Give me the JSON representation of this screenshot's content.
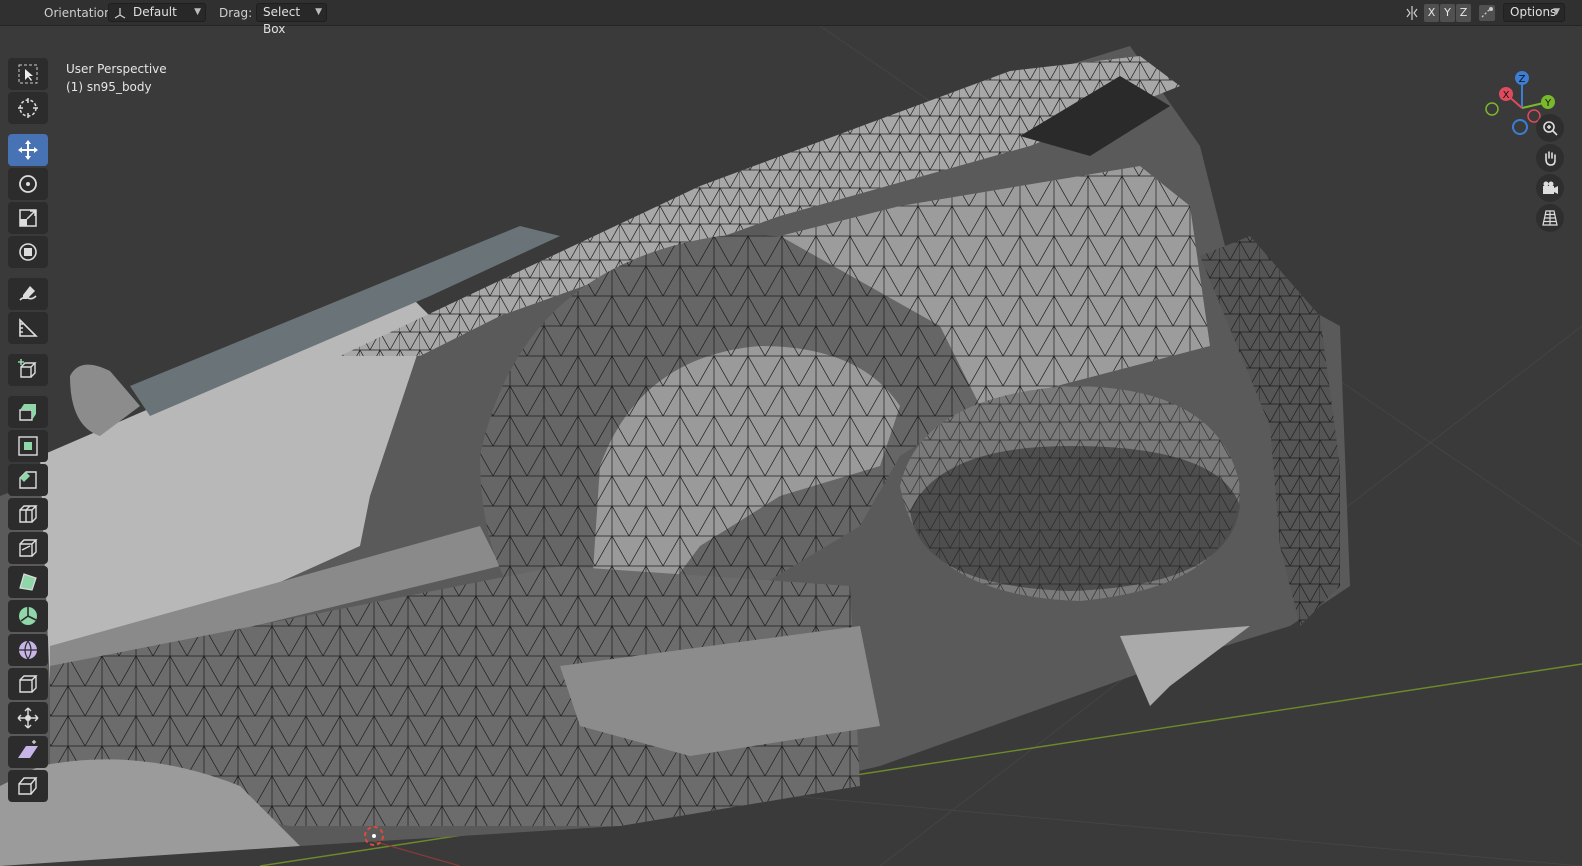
{
  "header": {
    "orientation_label": "Orientation:",
    "orientation_value": "Default",
    "drag_label": "Drag:",
    "drag_value": "Select Box",
    "axis_x": "X",
    "axis_y": "Y",
    "axis_z": "Z",
    "options_label": "Options"
  },
  "viewport": {
    "view_name": "User Perspective",
    "object_name": "(1) sn95_body"
  },
  "gizmo": {
    "x_label": "X",
    "y_label": "Y",
    "z_label": "Z",
    "x_color": "#e04a5d",
    "y_color": "#7ab82c",
    "z_color": "#3c7ed6"
  },
  "toolbar": {
    "tools": [
      "select-box",
      "cursor",
      "move",
      "rotate",
      "scale",
      "transform",
      "annotate",
      "measure",
      "add-cube",
      "extrude-region",
      "inset-faces",
      "bevel",
      "loop-cut",
      "knife",
      "poly-build",
      "spin",
      "smooth",
      "edge-slide",
      "shrink-fatten",
      "shear",
      "rip-region"
    ],
    "active_tool": "move",
    "accent": "#4772b3"
  },
  "navigation": [
    "zoom-icon",
    "pan-hand-icon",
    "camera-icon",
    "grid-perspective-icon"
  ]
}
